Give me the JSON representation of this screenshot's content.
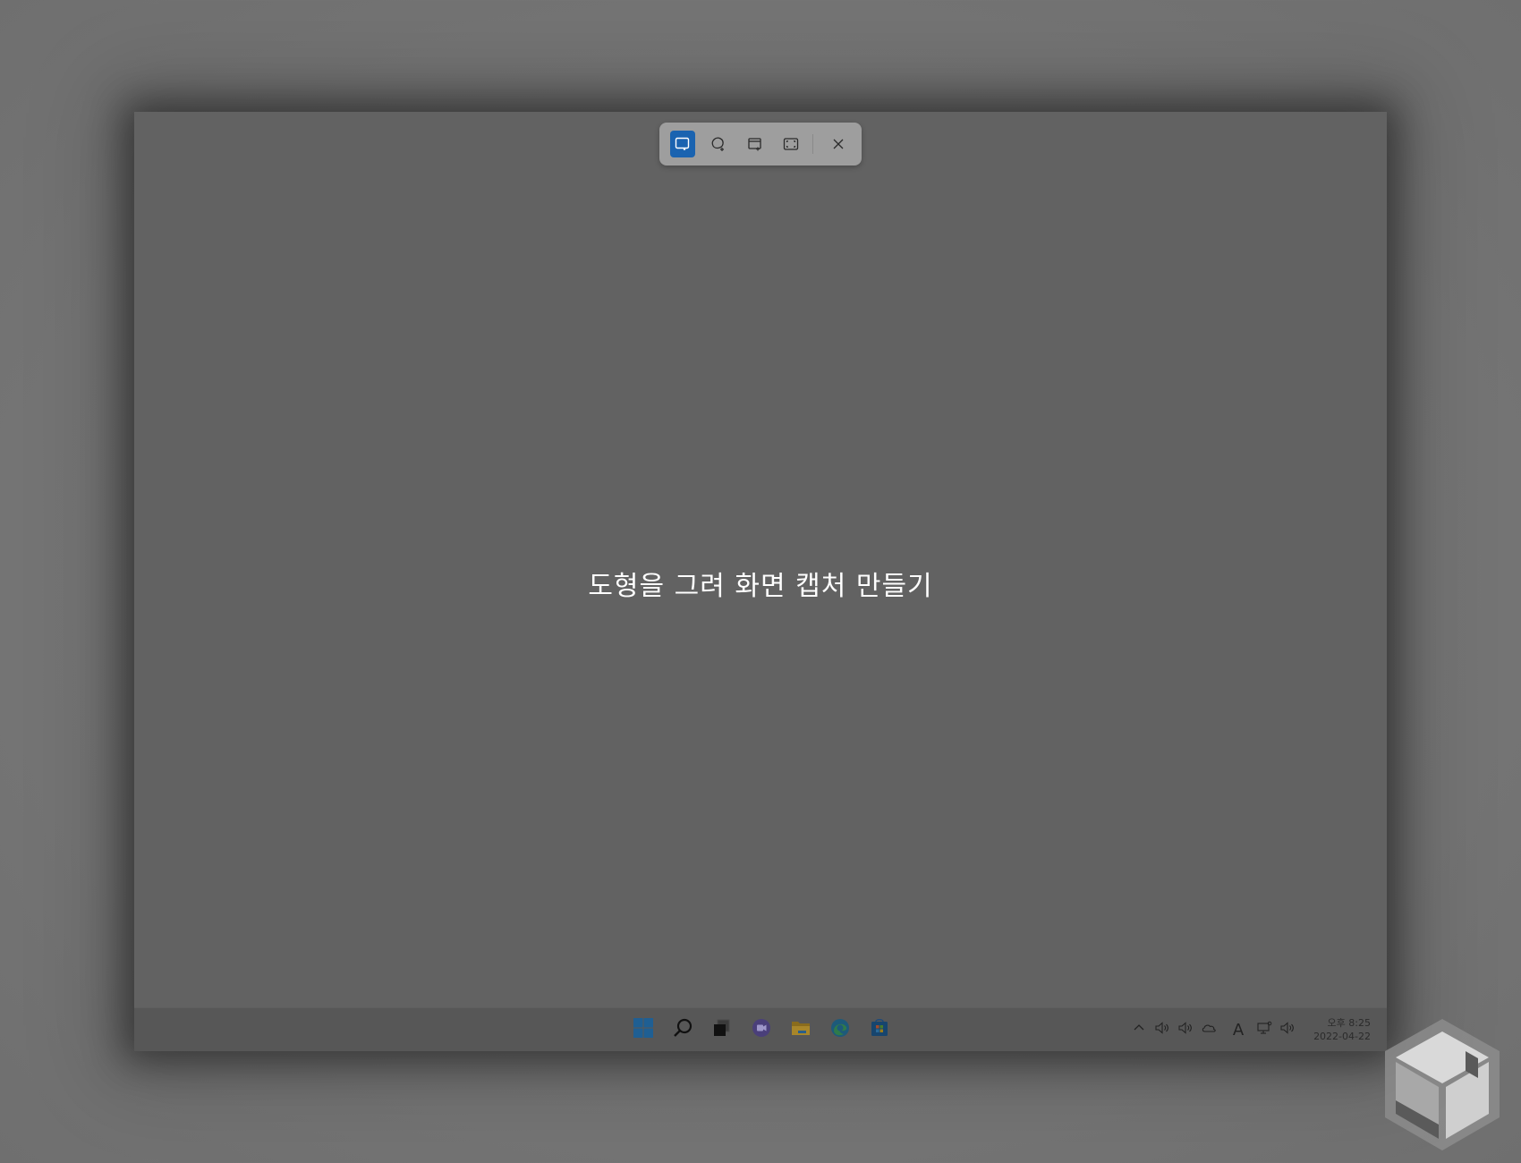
{
  "snip_toolbar": {
    "modes": [
      {
        "name": "rectangle-mode",
        "active": true
      },
      {
        "name": "freeform-mode",
        "active": false
      },
      {
        "name": "window-mode",
        "active": false
      },
      {
        "name": "fullscreen-mode",
        "active": false
      }
    ],
    "close_icon": "close-icon"
  },
  "prompt": {
    "text": "도형을 그려 화면 캡처 만들기"
  },
  "taskbar": {
    "apps": [
      "start-icon",
      "search-icon",
      "task-view-icon",
      "chat-icon",
      "file-explorer-icon",
      "edge-icon",
      "store-icon"
    ],
    "tray": {
      "input_indicator": "A",
      "time": "오후 8:25",
      "date": "2022-04-22"
    }
  },
  "colors": {
    "accent": "#1a63b0",
    "screen_dim": "#626262",
    "taskbar": "#575757"
  }
}
